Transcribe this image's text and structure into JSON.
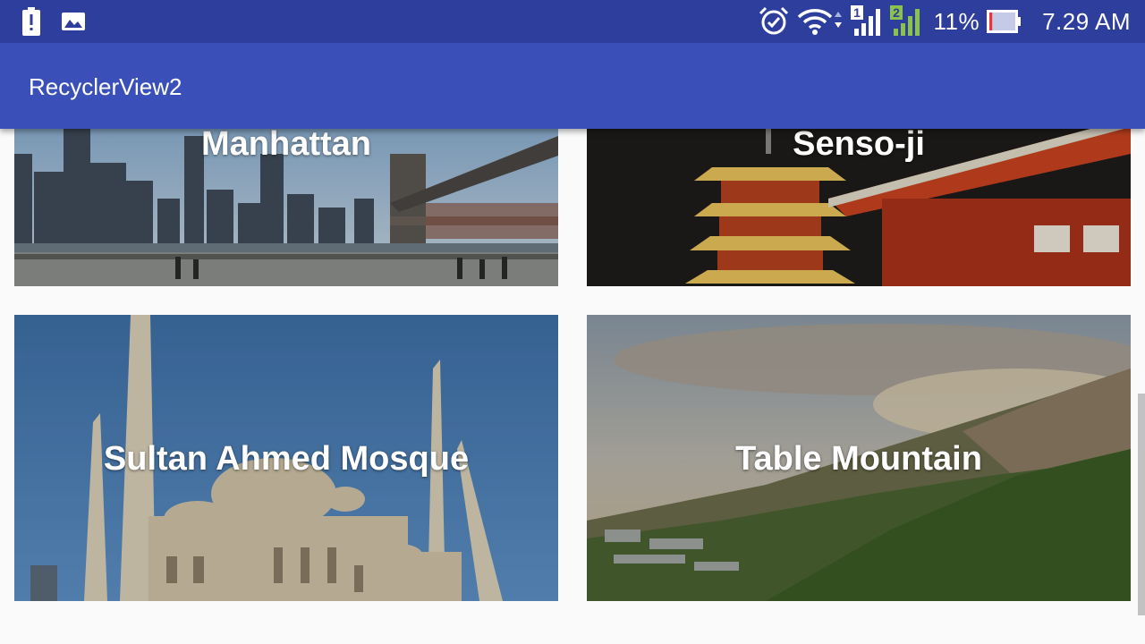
{
  "status_bar": {
    "left_icons": [
      "battery-alert-icon",
      "image-icon"
    ],
    "right_icons": [
      "alarm-icon",
      "wifi-icon",
      "signal-sim1-icon",
      "signal-sim2-icon",
      "battery-icon"
    ],
    "sim1_label": "1",
    "sim2_label": "2",
    "battery_percent": "11%",
    "battery_level": 0.11,
    "time": "7.29 AM"
  },
  "app_bar": {
    "title": "RecyclerView2",
    "color": "#3a50b8"
  },
  "cards": [
    {
      "title": "Manhattan"
    },
    {
      "title": "Senso-ji"
    },
    {
      "title": "Sultan Ahmed Mosque"
    },
    {
      "title": "Table Mountain"
    }
  ],
  "colors": {
    "status_bar": "#2e3e9c",
    "app_bar": "#3a50b8",
    "background": "#fafafa",
    "battery_low": "#e53935",
    "sim2_signal": "#8bc34a"
  }
}
